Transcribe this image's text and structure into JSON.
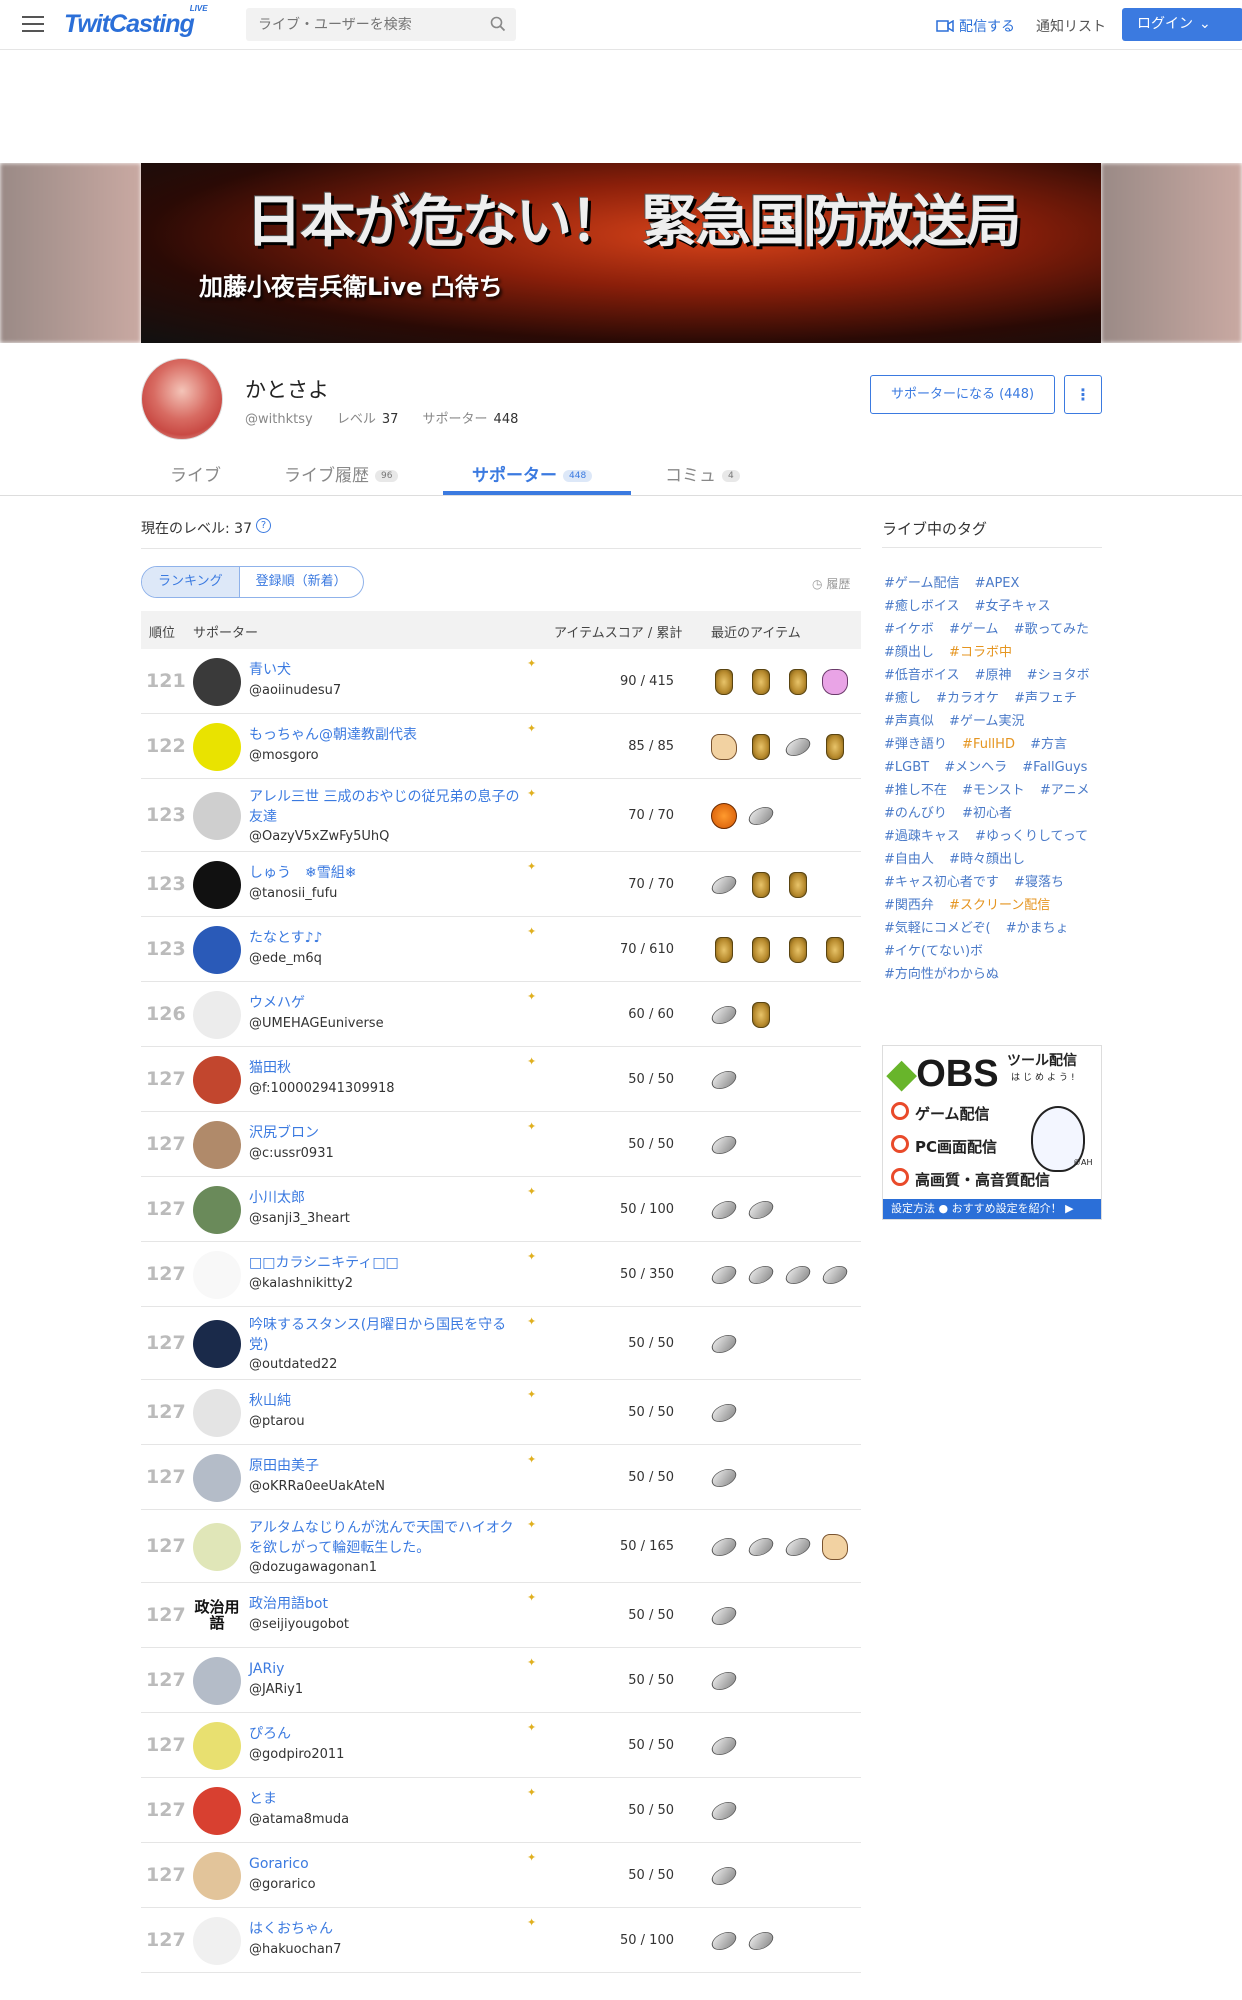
{
  "header": {
    "logo": "TwitCasting",
    "logo_sup": "LIVE",
    "search_placeholder": "ライブ・ユーザーを検索",
    "broadcast": "配信する",
    "notify": "通知リスト",
    "login": "ログイン"
  },
  "banner": {
    "title": "日本が危ない！ 緊急国防放送局",
    "subtitle": "加藤小夜吉兵衛Live 凸待ち"
  },
  "profile": {
    "name": "かとさよ",
    "handle": "@withktsy",
    "level_label": "レベル",
    "level": "37",
    "supporter_label": "サポーター",
    "supporters": "448",
    "become_supporter": "サポーターになる (448)"
  },
  "tabs": [
    {
      "label": "ライブ",
      "count": ""
    },
    {
      "label": "ライブ履歴",
      "count": "96"
    },
    {
      "label": "サポーター",
      "count": "448"
    },
    {
      "label": "コミュ",
      "count": "4"
    }
  ],
  "level_text": "現在のレベル: 37",
  "sort": {
    "ranking": "ランキング",
    "recent": "登録順（新着）",
    "history": "履歴"
  },
  "table_header": {
    "rank": "順位",
    "supporter": "サポーター",
    "score": "アイテムスコア / 累計",
    "items": "最近のアイテム"
  },
  "rows": [
    {
      "rank": "121",
      "name": "青い犬",
      "id": "@aoiinudesu7",
      "score": "90 / 415",
      "items": [
        "can",
        "can",
        "can",
        "pig"
      ],
      "avatar": "#3a3a3a"
    },
    {
      "rank": "122",
      "name": "もっちゃん@朝達教副代表",
      "id": "@mosgoro",
      "score": "85 / 85",
      "items": [
        "hand",
        "can",
        "coin",
        "can"
      ],
      "avatar": "#e9e300"
    },
    {
      "rank": "123",
      "name": "アレル三世 三成のおやじの従兄弟の息子の友達",
      "id": "@OazyV5xZwFy5UhQ",
      "score": "70 / 70",
      "items": [
        "pump",
        "coin"
      ],
      "avatar": "#cfcfcf"
    },
    {
      "rank": "123",
      "name": "しゅう　❄雪組❄",
      "id": "@tanosii_fufu",
      "score": "70 / 70",
      "items": [
        "coin",
        "can",
        "can"
      ],
      "avatar": "#111111"
    },
    {
      "rank": "123",
      "name": "たなとす♪♪",
      "id": "@ede_m6q",
      "score": "70 / 610",
      "items": [
        "can",
        "can",
        "can",
        "can"
      ],
      "avatar": "#2a5ab8"
    },
    {
      "rank": "126",
      "name": "ウメハゲ",
      "id": "@UMEHAGEuniverse",
      "score": "60 / 60",
      "items": [
        "coin",
        "can"
      ],
      "avatar": "#ececec"
    },
    {
      "rank": "127",
      "name": "猫田秋",
      "id": "@f:100002941309918",
      "score": "50 / 50",
      "items": [
        "coin"
      ],
      "avatar": "#c2462e"
    },
    {
      "rank": "127",
      "name": "沢尻ブロン",
      "id": "@c:ussr0931",
      "score": "50 / 50",
      "items": [
        "coin"
      ],
      "avatar": "#b08a6a"
    },
    {
      "rank": "127",
      "name": "小川太郎",
      "id": "@sanji3_3heart",
      "score": "50 / 100",
      "items": [
        "coin",
        "coin"
      ],
      "avatar": "#6a8a5a"
    },
    {
      "rank": "127",
      "name": "□□カラシニキティ□□",
      "id": "@kalashnikitty2",
      "score": "50 / 350",
      "items": [
        "coin",
        "coin",
        "coin",
        "coin"
      ],
      "avatar": "#f8f8f8"
    },
    {
      "rank": "127",
      "name": "吟味するスタンス(月曜日から国民を守る党)",
      "id": "@outdated22",
      "score": "50 / 50",
      "items": [
        "coin"
      ],
      "avatar": "#1a2a4a"
    },
    {
      "rank": "127",
      "name": "秋山純",
      "id": "@ptarou",
      "score": "50 / 50",
      "items": [
        "coin"
      ],
      "avatar": "#e4e4e4"
    },
    {
      "rank": "127",
      "name": "原田由美子",
      "id": "@oKRRa0eeUakAteN",
      "score": "50 / 50",
      "items": [
        "coin"
      ],
      "avatar": "#b4bcc8"
    },
    {
      "rank": "127",
      "name": "アルタムなじりんが沈んで天国でハイオクを欲しがって輪廻転生した。",
      "id": "@dozugawagonan1",
      "score": "50 / 165",
      "items": [
        "coin",
        "coin",
        "coin",
        "hand"
      ],
      "avatar": "#e0e6b8"
    },
    {
      "rank": "127",
      "name": "政治用語bot",
      "id": "@seijiyougobot",
      "score": "50 / 50",
      "items": [
        "coin"
      ],
      "avatar": "#ffffff",
      "avatar_text": "政治用語"
    },
    {
      "rank": "127",
      "name": "JARiy",
      "id": "@JARiy1",
      "score": "50 / 50",
      "items": [
        "coin"
      ],
      "avatar": "#b4bcc8"
    },
    {
      "rank": "127",
      "name": "ぴろん",
      "id": "@godpiro2011",
      "score": "50 / 50",
      "items": [
        "coin"
      ],
      "avatar": "#e8e070"
    },
    {
      "rank": "127",
      "name": "とま",
      "id": "@atama8muda",
      "score": "50 / 50",
      "items": [
        "coin"
      ],
      "avatar": "#d84030"
    },
    {
      "rank": "127",
      "name": "Gorarico",
      "id": "@gorarico",
      "score": "50 / 50",
      "items": [
        "coin"
      ],
      "avatar": "#e2c49a"
    },
    {
      "rank": "127",
      "name": "はくおちゃん",
      "id": "@hakuochan7",
      "score": "50 / 100",
      "items": [
        "coin",
        "coin"
      ],
      "avatar": "#f0f0f0"
    }
  ],
  "sidebar": {
    "title": "ライブ中のタグ",
    "tags": [
      {
        "t": "#ゲーム配信",
        "hl": false
      },
      {
        "t": "#APEX",
        "hl": false
      },
      {
        "t": "#癒しボイス",
        "hl": false
      },
      {
        "t": "#女子キャス",
        "hl": false
      },
      {
        "t": "#イケボ",
        "hl": false
      },
      {
        "t": "#ゲーム",
        "hl": false
      },
      {
        "t": "#歌ってみた",
        "hl": false
      },
      {
        "t": "#顔出し",
        "hl": false
      },
      {
        "t": "#コラボ中",
        "hl": true
      },
      {
        "t": "#低音ボイス",
        "hl": false
      },
      {
        "t": "#原神",
        "hl": false
      },
      {
        "t": "#ショタボ",
        "hl": false
      },
      {
        "t": "#癒し",
        "hl": false
      },
      {
        "t": "#カラオケ",
        "hl": false
      },
      {
        "t": "#声フェチ",
        "hl": false
      },
      {
        "t": "#声真似",
        "hl": false
      },
      {
        "t": "#ゲーム実況",
        "hl": false
      },
      {
        "t": "#弾き語り",
        "hl": false
      },
      {
        "t": "#FullHD",
        "hl": true
      },
      {
        "t": "#方言",
        "hl": false
      },
      {
        "t": "#LGBT",
        "hl": false
      },
      {
        "t": "#メンヘラ",
        "hl": false
      },
      {
        "t": "#FallGuys",
        "hl": false
      },
      {
        "t": "#推し不在",
        "hl": false
      },
      {
        "t": "#モンスト",
        "hl": false
      },
      {
        "t": "#アニメ",
        "hl": false
      },
      {
        "t": "#のんびり",
        "hl": false
      },
      {
        "t": "#初心者",
        "hl": false
      },
      {
        "t": "#過疎キャス",
        "hl": false
      },
      {
        "t": "#ゆっくりしてって",
        "hl": false
      },
      {
        "t": "#自由人",
        "hl": false
      },
      {
        "t": "#時々顔出し",
        "hl": false
      },
      {
        "t": "#キャス初心者です",
        "hl": false
      },
      {
        "t": "#寝落ち",
        "hl": false
      },
      {
        "t": "#関西弁",
        "hl": false
      },
      {
        "t": "#スクリーン配信",
        "hl": true
      },
      {
        "t": "#気軽にコメどぞ(",
        "hl": false
      },
      {
        "t": "#かまちょ",
        "hl": false
      },
      {
        "t": "#イケ(てない)ボ",
        "hl": false
      },
      {
        "t": "#方向性がわからぬ",
        "hl": false
      }
    ],
    "ad": {
      "logo": "OBS",
      "title": "ツール配信",
      "sub": "はじめよう!",
      "items": [
        "ゲーム配信",
        "PC画面配信",
        "高画質・高音質配信"
      ],
      "mark": "©AH",
      "footer": "設定方法 ● おすすめ設定を紹介！ ▶"
    }
  }
}
